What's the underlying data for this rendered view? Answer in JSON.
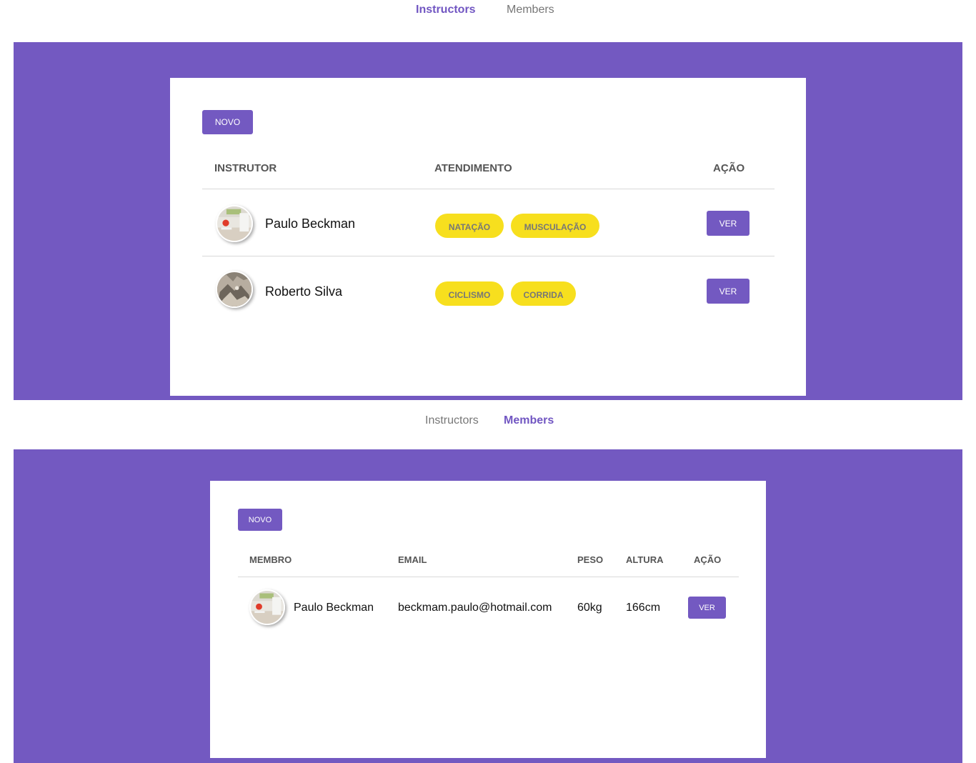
{
  "colors": {
    "accent": "#7359c1",
    "pill": "#f7df1e"
  },
  "instructors_view": {
    "nav": {
      "instructors": "Instructors",
      "members": "Members"
    },
    "new_button": "NOVO",
    "headers": {
      "instructor": "INSTRUTOR",
      "service": "ATENDIMENTO",
      "action": "AÇÃO"
    },
    "rows": [
      {
        "name": "Paulo Beckman",
        "services": [
          "NATAÇÃO",
          "MUSCULAÇÃO"
        ],
        "action": "VER",
        "avatar": "desk-photo"
      },
      {
        "name": "Roberto Silva",
        "services": [
          "CICLISMO",
          "CORRIDA"
        ],
        "action": "VER",
        "avatar": "rocks-photo"
      }
    ]
  },
  "members_view": {
    "nav": {
      "instructors": "Instructors",
      "members": "Members"
    },
    "new_button": "NOVO",
    "headers": {
      "member": "MEMBRO",
      "email": "EMAIL",
      "weight": "PESO",
      "height": "ALTURA",
      "action": "AÇÃO"
    },
    "rows": [
      {
        "name": "Paulo Beckman",
        "email": "beckmam.paulo@hotmail.com",
        "weight": "60kg",
        "height": "166cm",
        "action": "VER",
        "avatar": "desk-photo"
      }
    ]
  }
}
